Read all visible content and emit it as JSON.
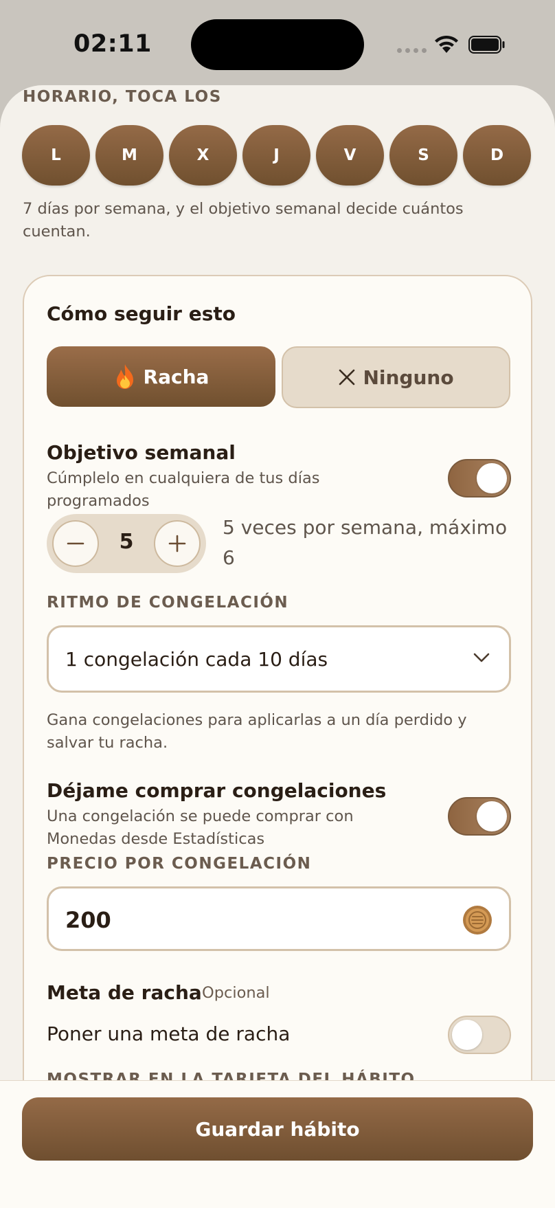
{
  "status_bar": {
    "time": "02:11"
  },
  "schedule": {
    "heading_partial": "HORARIO, TOCA LOS",
    "days": [
      "L",
      "M",
      "X",
      "J",
      "V",
      "S",
      "D"
    ],
    "note": "7 días por semana, y el objetivo semanal decide cuántos cuentan."
  },
  "tracking": {
    "title": "Cómo seguir esto",
    "option_streak": "Racha",
    "option_none": "Ninguno",
    "selected": "Racha"
  },
  "weekly_goal": {
    "title": "Objetivo semanal",
    "subtitle": "Cúmplelo en cualquiera de tus días programados",
    "enabled": true,
    "value": "5",
    "description": "5 veces por semana, máximo 6"
  },
  "freeze_rhythm": {
    "label": "RITMO DE CONGELACIÓN",
    "selected": "1 congelación cada 10 días",
    "help": "Gana congelaciones para aplicarlas a un día perdido y salvar tu racha."
  },
  "buy_freezes": {
    "title": "Déjame comprar congelaciones",
    "subtitle": "Una congelación se puede comprar con Monedas desde Estadísticas",
    "enabled": true
  },
  "freeze_price": {
    "label": "PRECIO POR CONGELACIÓN",
    "value": "200"
  },
  "streak_goal": {
    "title": "Meta de racha",
    "optional": "Opcional",
    "toggle_label": "Poner una meta de racha",
    "enabled": false
  },
  "show_on_card": {
    "label_partial": "MOSTRAR EN LA TARJETA DEL HÁBITO"
  },
  "footer": {
    "save_label": "Guardar hábito"
  },
  "colors": {
    "accent_brown": "#8a6140",
    "background": "#f4f1eb",
    "card": "#fdfbf6"
  }
}
